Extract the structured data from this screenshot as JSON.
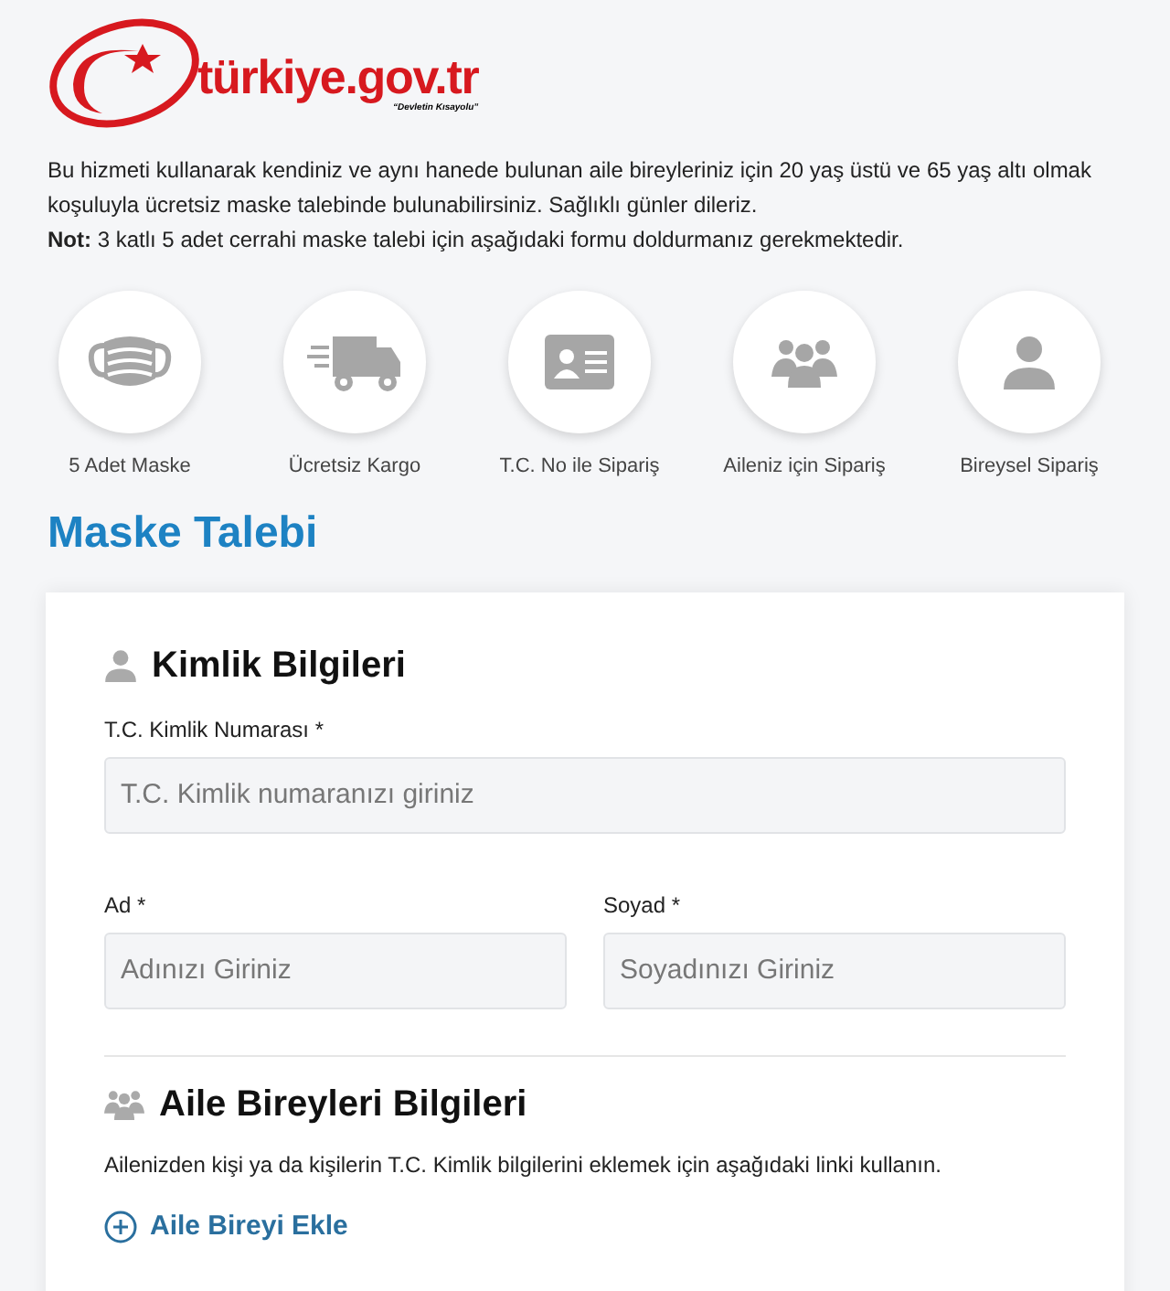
{
  "logo": {
    "text": "türkiye.gov.tr",
    "tagline": "“Devletin Kısayolu”"
  },
  "intro": "Bu hizmeti kullanarak kendiniz ve aynı hanede bulunan aile bireyleriniz için 20 yaş üstü ve 65 yaş altı olmak koşuluyla ücretsiz maske talebinde bulunabilirsiniz. Sağlıklı günler dileriz.",
  "note": "**Not:** 3 katlı 5 adet cerrahi maske talebi için aşağıdaki formu doldurmanız gerekmektedir.",
  "features": [
    {
      "kind": "mask",
      "label": "5 Adet Maske"
    },
    {
      "kind": "truck",
      "label": "Ücretsiz Kargo"
    },
    {
      "kind": "idcard",
      "label": "T.C. No ile Sipariş"
    },
    {
      "kind": "group",
      "label": "Aileniz için Sipariş"
    },
    {
      "kind": "person",
      "label": "Bireysel Sipariş"
    }
  ],
  "title": "Maske Talebi",
  "identity": {
    "heading": "Kimlik Bilgileri",
    "fields": [
      {
        "label": "T.C. Kimlik Numarası *",
        "placeholder": "T.C. Kimlik numaranızı giriniz"
      },
      {
        "label": "Ad *",
        "placeholder": "Adınızı Giriniz"
      },
      {
        "label": "Soyad *",
        "placeholder": "Soyadınızı Giriniz"
      }
    ]
  },
  "family": {
    "heading": "Aile Bireyleri Bilgileri",
    "text": "Ailenizden kişi ya da kişilerin T.C. Kimlik bilgilerini eklemek için aşağıdaki linki kullanın.",
    "link": "Aile Bireyi Ekle"
  }
}
